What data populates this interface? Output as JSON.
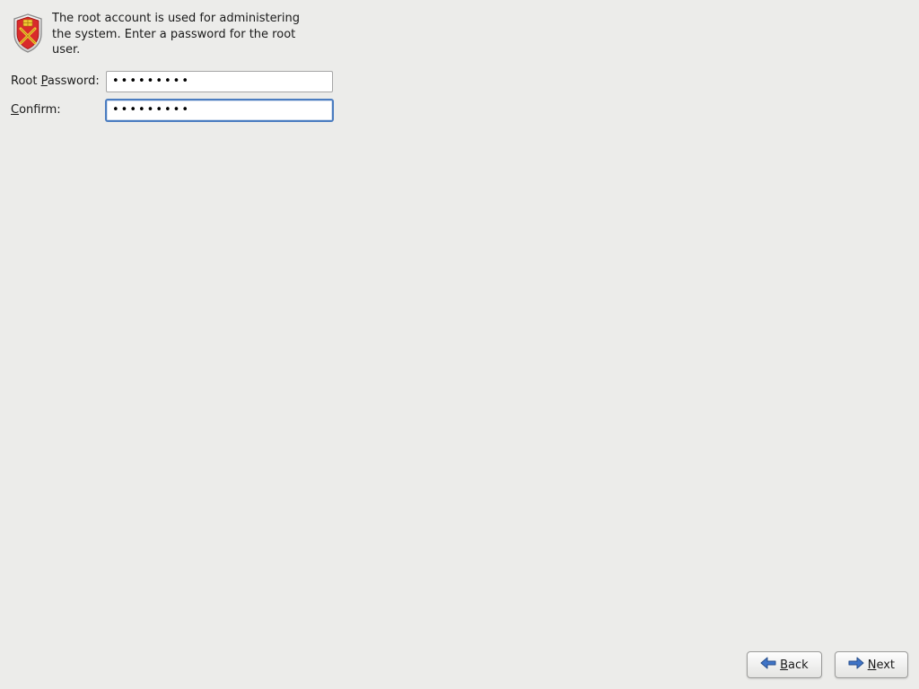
{
  "intro": "The root account is used for administering the system.  Enter a password for the root user.",
  "labels": {
    "root_password_prefix": "Root ",
    "root_password_accel": "P",
    "root_password_suffix": "assword:",
    "confirm_accel": "C",
    "confirm_suffix": "onfirm:"
  },
  "fields": {
    "root_password": "•••••••••",
    "confirm": "•••••••••"
  },
  "buttons": {
    "back_accel": "B",
    "back_rest": "ack",
    "next_accel": "N",
    "next_rest": "ext"
  }
}
